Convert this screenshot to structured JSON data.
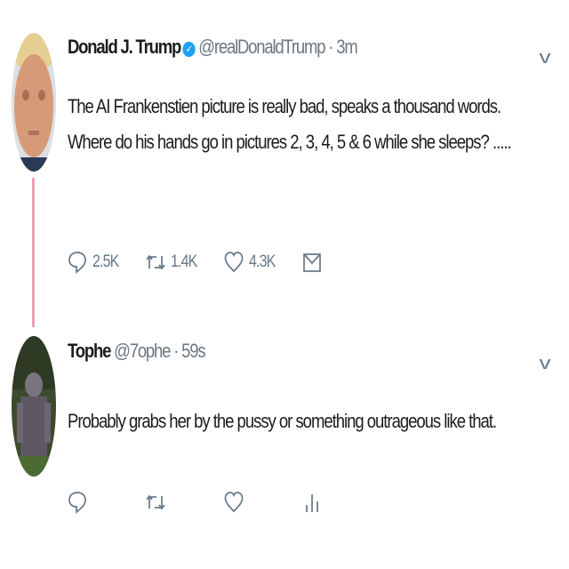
{
  "tweets": [
    {
      "name": "Donald J. Trump",
      "verified": true,
      "handle": "@realDonaldTrump",
      "separator": "·",
      "time": "3m",
      "text": "The AI Frankenstien picture is really bad, speaks a thousand words. Where do his hands go in pictures 2, 3, 4, 5 & 6 while she sleeps? .....",
      "actions": {
        "reply_count": "2.5K",
        "retweet_count": "1.4K",
        "like_count": "4.3K"
      }
    },
    {
      "name": "Tophe",
      "verified": false,
      "handle": "@7ophe",
      "separator": "·",
      "time": "59s",
      "text": "Probably grabs her by the pussy or something outrageous like that.",
      "actions": {
        "reply_count": "",
        "retweet_count": "",
        "like_count": ""
      }
    }
  ],
  "icons": {
    "reply": "reply-icon",
    "retweet": "retweet-icon",
    "like": "heart-icon",
    "dm": "envelope-icon",
    "analytics": "analytics-icon",
    "more": "chevron-down-icon",
    "verified": "verified-badge-icon"
  },
  "colors": {
    "thread_line": "#e6a3b1",
    "verified_badge": "#1da1f2",
    "muted_text": "#6d7780"
  }
}
